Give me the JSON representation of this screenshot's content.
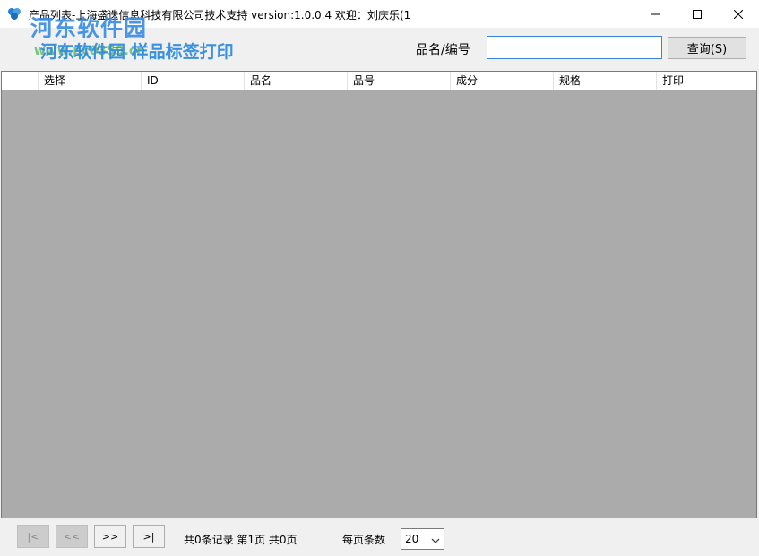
{
  "window": {
    "title": "产品列表-上海盛迭信息科技有限公司技术支持 version:1.0.0.4 欢迎：刘庆乐(1",
    "icon": "app-logo-icon"
  },
  "watermark": {
    "logo_text": "河东软件园",
    "url_text": "www.pc0359.cn"
  },
  "app": {
    "heading": "河东软件园 样品标签打印"
  },
  "search": {
    "label": "品名/编号",
    "value": "",
    "button_label": "查询(S)"
  },
  "grid": {
    "columns": [
      "选择",
      "ID",
      "品名",
      "品号",
      "成分",
      "规格",
      "打印"
    ],
    "rows": []
  },
  "pager": {
    "first_label": "|<",
    "prev_label": "<<",
    "next_label": ">>",
    "last_label": ">|",
    "info": "共0条记录 第1页 共0页",
    "page_size_label": "每页条数",
    "page_size": "20"
  },
  "colors": {
    "grid_background": "#ababab",
    "accent": "#3c82d6"
  }
}
